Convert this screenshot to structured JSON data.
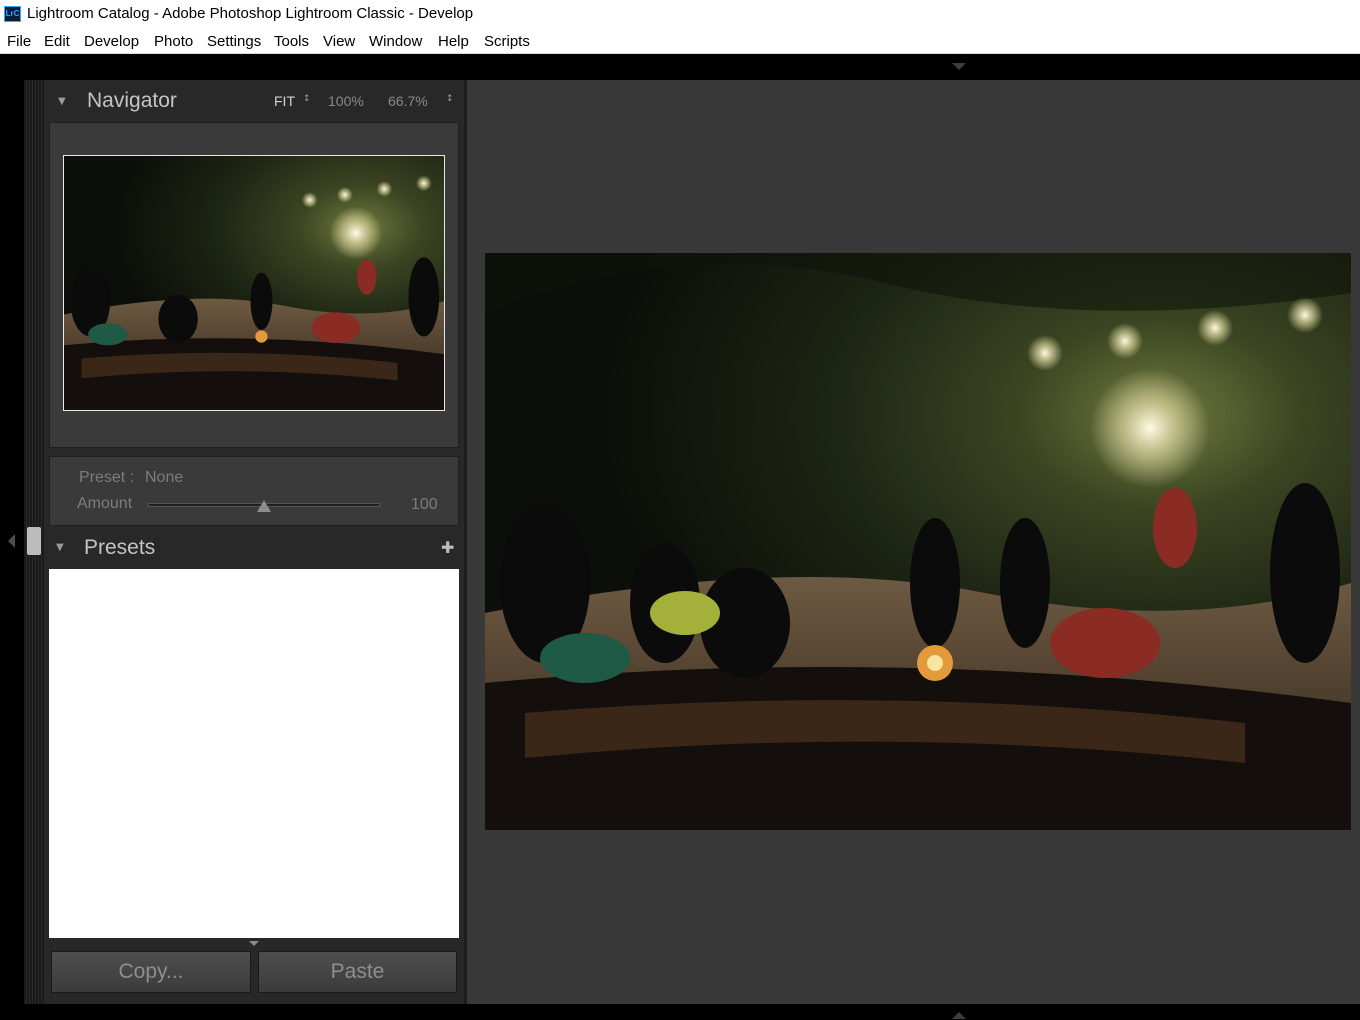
{
  "window": {
    "title": "Lightroom Catalog - Adobe Photoshop Lightroom Classic - Develop",
    "app_icon_text": "LrC",
    "app_icon_color": "#31a8ff"
  },
  "menu": [
    "File",
    "Edit",
    "Develop",
    "Photo",
    "Settings",
    "Tools",
    "View",
    "Window",
    "Help",
    "Scripts"
  ],
  "navigator": {
    "title": "Navigator",
    "zoom_fit": "FIT",
    "zoom_100": "100%",
    "zoom_custom": "66.7%"
  },
  "preset_amount": {
    "preset_label": "Preset :",
    "preset_value": "None",
    "amount_label": "Amount",
    "amount_value": "100",
    "amount_fraction": 0.5
  },
  "presets": {
    "title": "Presets"
  },
  "buttons": {
    "copy": "Copy...",
    "paste": "Paste"
  },
  "colors": {
    "panel_bg": "#282828",
    "main_bg": "#393939",
    "accent": "#31a8ff"
  },
  "icons": {
    "collapse_navigator": "disclosure-triangle-icon",
    "collapse_presets": "disclosure-triangle-icon",
    "add_preset": "plus-icon",
    "left_panel_toggle": "left-arrow-icon",
    "top_panel_toggle": "down-arrow-icon",
    "bottom_panel_toggle": "up-arrow-icon"
  }
}
